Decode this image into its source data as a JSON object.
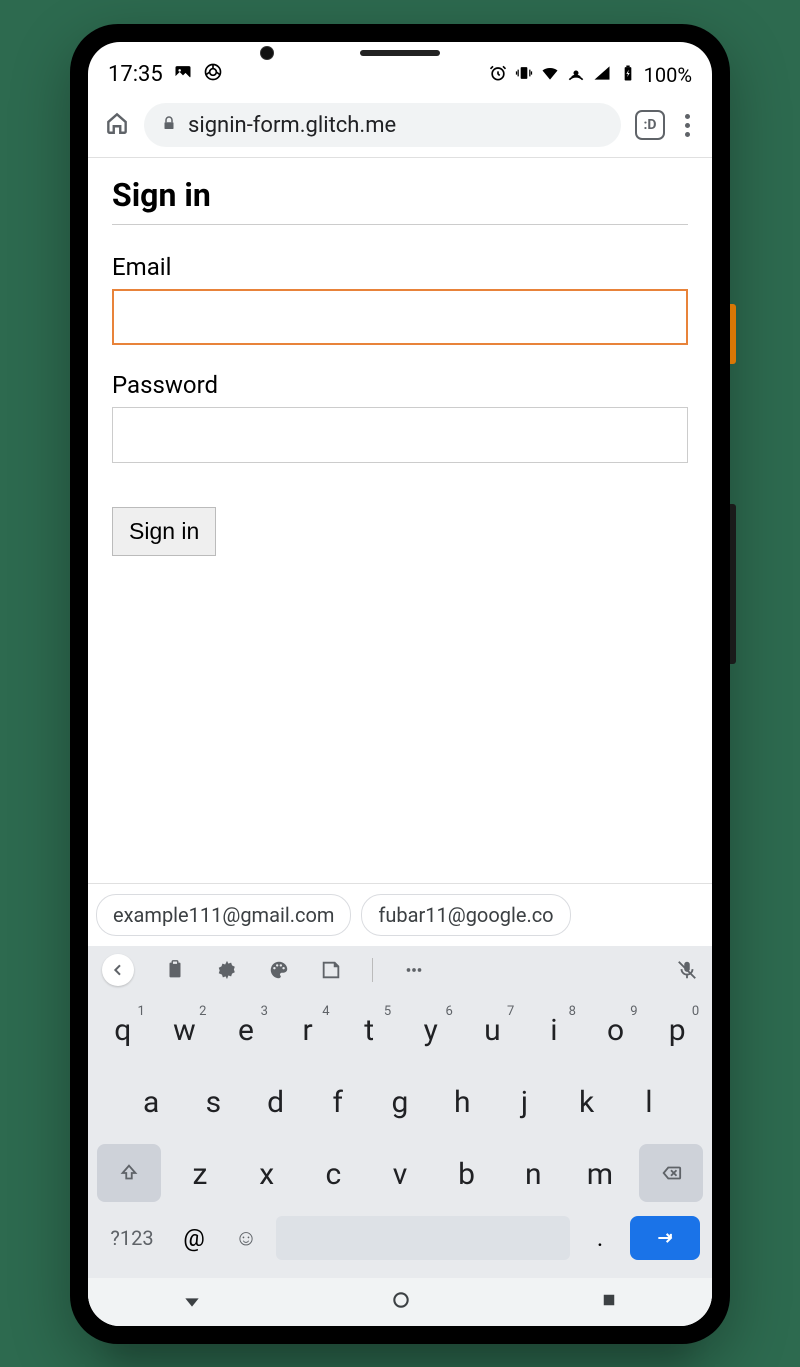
{
  "status": {
    "time": "17:35",
    "battery": "100%"
  },
  "browser": {
    "url": "signin-form.glitch.me",
    "tab_indicator": ":D"
  },
  "page": {
    "title": "Sign in",
    "email_label": "Email",
    "email_value": "",
    "password_label": "Password",
    "password_value": "",
    "submit_label": "Sign in"
  },
  "suggestions": [
    "example111@gmail.com",
    "fubar11@google.co"
  ],
  "keyboard": {
    "row1": [
      {
        "key": "q",
        "sup": "1"
      },
      {
        "key": "w",
        "sup": "2"
      },
      {
        "key": "e",
        "sup": "3"
      },
      {
        "key": "r",
        "sup": "4"
      },
      {
        "key": "t",
        "sup": "5"
      },
      {
        "key": "y",
        "sup": "6"
      },
      {
        "key": "u",
        "sup": "7"
      },
      {
        "key": "i",
        "sup": "8"
      },
      {
        "key": "o",
        "sup": "9"
      },
      {
        "key": "p",
        "sup": "0"
      }
    ],
    "row2": [
      "a",
      "s",
      "d",
      "f",
      "g",
      "h",
      "j",
      "k",
      "l"
    ],
    "row3": [
      "z",
      "x",
      "c",
      "v",
      "b",
      "n",
      "m"
    ],
    "symbols_key": "?123",
    "at_key": "@",
    "period_key": "."
  }
}
